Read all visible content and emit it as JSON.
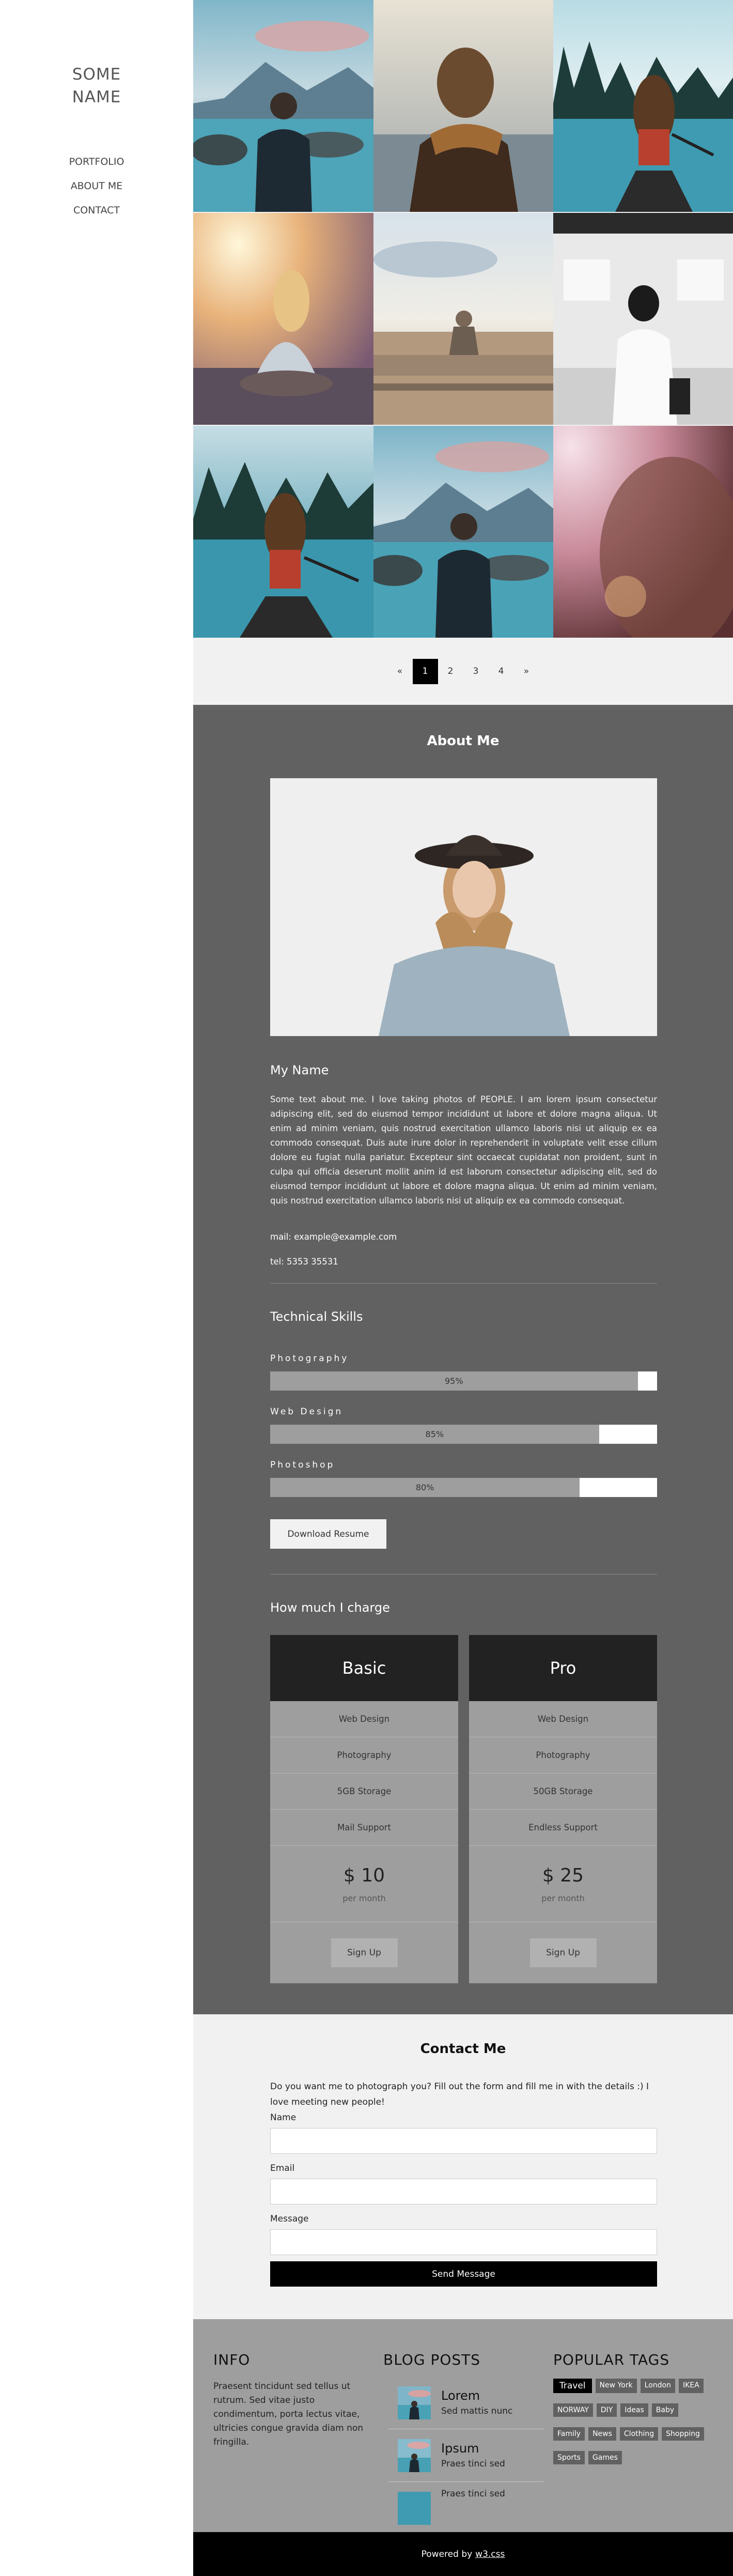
{
  "sidebar": {
    "brand_line1": "SOME",
    "brand_line2": "NAME",
    "nav": [
      "PORTFOLIO",
      "ABOUT ME",
      "CONTACT"
    ]
  },
  "pagination": {
    "prev": "«",
    "pages": [
      "1",
      "2",
      "3",
      "4"
    ],
    "next": "»",
    "active_page": "1"
  },
  "about": {
    "title": "About Me",
    "name": "My Name",
    "text": "Some text about me. I love taking photos of PEOPLE. I am lorem ipsum consectetur adipiscing elit, sed do eiusmod tempor incididunt ut labore et dolore magna aliqua. Ut enim ad minim veniam, quis nostrud exercitation ullamco laboris nisi ut aliquip ex ea commodo consequat. Duis aute irure dolor in reprehenderit in voluptate velit esse cillum dolore eu fugiat nulla pariatur. Excepteur sint occaecat cupidatat non proident, sunt in culpa qui officia deserunt mollit anim id est laborum consectetur adipiscing elit, sed do eiusmod tempor incididunt ut labore et dolore magna aliqua. Ut enim ad minim veniam, quis nostrud exercitation ullamco laboris nisi ut aliquip ex ea commodo consequat.",
    "mail": "mail: example@example.com",
    "tel": "tel: 5353 35531"
  },
  "skills": {
    "title": "Technical Skills",
    "items": [
      {
        "label": "Photography",
        "percent": "95%"
      },
      {
        "label": "Web Design",
        "percent": "85%"
      },
      {
        "label": "Photoshop",
        "percent": "80%"
      }
    ],
    "download_label": "Download Resume"
  },
  "pricing": {
    "title": "How much I charge",
    "plans": [
      {
        "name": "Basic",
        "features": [
          "Web Design",
          "Photography",
          "5GB Storage",
          "Mail Support"
        ],
        "price": "$ 10",
        "period": "per month",
        "cta": "Sign Up"
      },
      {
        "name": "Pro",
        "features": [
          "Web Design",
          "Photography",
          "50GB Storage",
          "Endless Support"
        ],
        "price": "$ 25",
        "period": "per month",
        "cta": "Sign Up"
      }
    ]
  },
  "contact": {
    "title": "Contact Me",
    "text": "Do you want me to photograph you? Fill out the form and fill me in with the details :) I love meeting new people!",
    "name_label": "Name",
    "email_label": "Email",
    "message_label": "Message",
    "send_label": "Send Message"
  },
  "footer": {
    "info_title": "INFO",
    "info_text": "Praesent tincidunt sed tellus ut rutrum. Sed vitae justo condimentum, porta lectus vitae, ultricies congue gravida diam non fringilla.",
    "blog_title": "BLOG POSTS",
    "posts": [
      {
        "title": "Lorem",
        "sub": "Sed mattis nunc"
      },
      {
        "title": "Ipsum",
        "sub": "Praes tinci sed"
      },
      {
        "title": "",
        "sub": "Praes tinci sed"
      }
    ],
    "tags_title": "POPULAR TAGS",
    "tags": [
      [
        "Travel",
        "New York",
        "London",
        "IKEA"
      ],
      [
        "NORWAY",
        "DIY",
        "Ideas",
        "Baby"
      ],
      [
        "Family",
        "News",
        "Clothing",
        "Shopping"
      ],
      [
        "Sports",
        "Games"
      ]
    ],
    "powered_by": "Powered by",
    "powered_link": "w3.css"
  }
}
